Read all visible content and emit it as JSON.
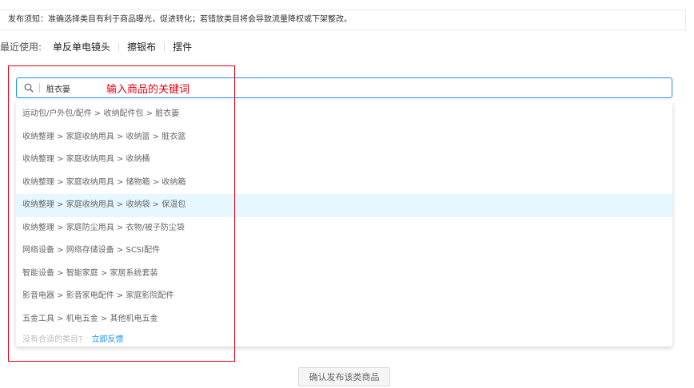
{
  "notice": {
    "text": "发布须知：准确选择类目有利于商品曝光，促进转化；若错放类目将会导致流量降权或下架整改。"
  },
  "recent": {
    "label": "最近使用:",
    "items": [
      "单反单电镜头",
      "擦银布",
      "摆件"
    ]
  },
  "search": {
    "value": "脏衣篓",
    "icon": "search-icon"
  },
  "annotation": {
    "label": "输入商品的关键词",
    "color": "#e60012"
  },
  "dropdown": {
    "items": [
      "运动包/户外包/配件 > 收纳配件包 > 脏衣篓",
      "收纳整理 > 家庭收纳用具 > 收纳篮 > 脏衣篮",
      "收纳整理 > 家庭收纳用具 > 收纳桶",
      "收纳整理 > 家庭收纳用具 > 储物箱 > 收纳箱",
      "收纳整理 > 家庭收纳用具 > 收纳袋 > 保温包",
      "收纳整理 > 家庭防尘用具 > 衣物/被子防尘袋",
      "网络设备 > 网络存储设备 > SCSI配件",
      "智能设备 > 智能家庭 > 家居系统套装",
      "影音电器 > 影音家电配件 > 家庭影院配件",
      "五金工具 > 机电五金 > 其他机电五金"
    ],
    "footer_text": "没有合适的类目?",
    "footer_link": "立即反馈"
  },
  "confirm": {
    "label": "确认发布该类商品"
  },
  "colors": {
    "accent": "#1890ff",
    "highlight": "#e6f7ff",
    "annotation": "#e60012"
  }
}
